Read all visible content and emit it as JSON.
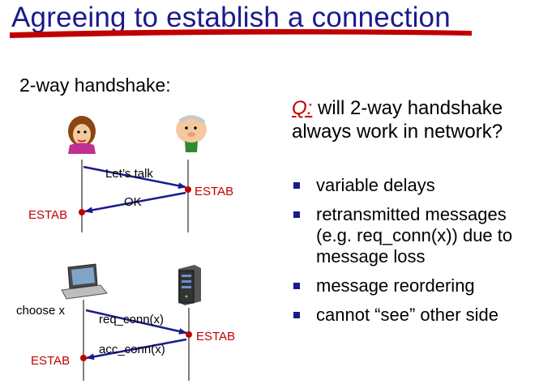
{
  "slide": {
    "title": "Agreeing to establish a connection",
    "subtitle": "2-way handshake:",
    "question_label": "Q:",
    "question_text": "will 2-way handshake always work in network?",
    "bullets": [
      "variable delays",
      "retransmitted messages (e.g. req_conn(x)) due to message loss",
      "message reordering",
      "cannot “see” other side"
    ]
  },
  "diagram_top": {
    "msg1": "Let’s talk",
    "msg2": "OK",
    "right_state": "ESTAB",
    "left_state": "ESTAB"
  },
  "diagram_bottom": {
    "left_action": "choose x",
    "msg1": "req_conn(x)",
    "msg2": "acc_conn(x)",
    "right_state": "ESTAB",
    "left_state": "ESTAB"
  },
  "colors": {
    "title": "#1a1a8c",
    "accent_red": "#c00000",
    "arrow": "#1a1a8c",
    "estab": "#c00000",
    "bullet": "#1a1a8c"
  },
  "icons": [
    "woman-cartoon-icon",
    "man-cartoon-icon",
    "laptop-icon",
    "server-icon"
  ]
}
